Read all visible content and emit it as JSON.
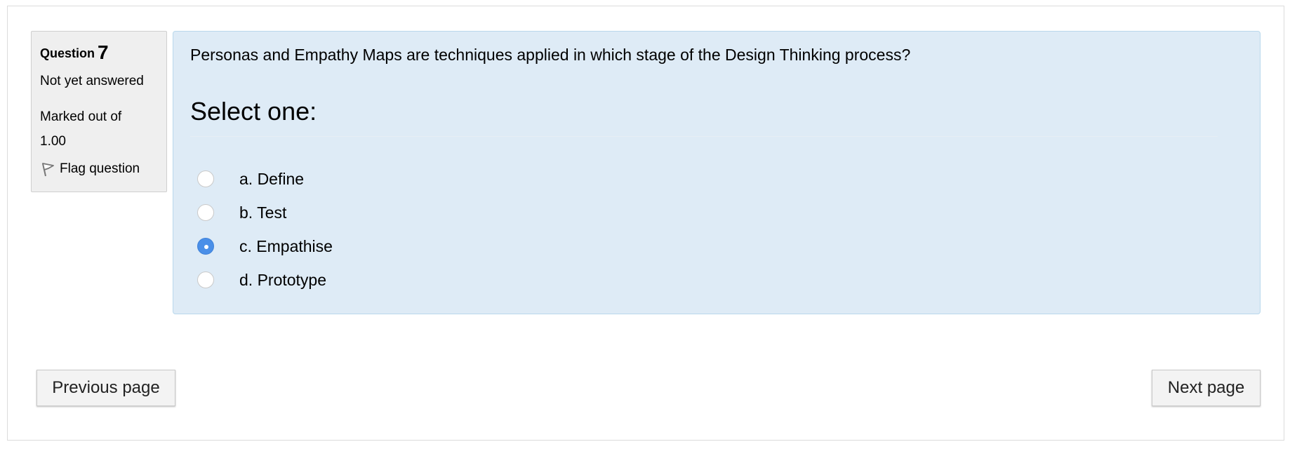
{
  "question_info": {
    "label": "Question",
    "number": "7",
    "state": "Not yet answered",
    "marked_line1": "Marked out of",
    "marked_line2": "1.00",
    "flag_label": "Flag question"
  },
  "question": {
    "text": "Personas and Empathy Maps are techniques applied in which stage of the Design Thinking process?",
    "prompt": "Select one:",
    "answers": [
      {
        "label": "a. Define",
        "checked": false
      },
      {
        "label": "b. Test",
        "checked": false
      },
      {
        "label": "c. Empathise",
        "checked": true
      },
      {
        "label": "d. Prototype",
        "checked": false
      }
    ]
  },
  "navigation": {
    "previous_label": "Previous page",
    "next_label": "Next page"
  },
  "colors": {
    "content_bg": "#deebf6",
    "info_bg": "#efefef",
    "radio_checked": "#4a8fe8"
  },
  "icons": {
    "flag": "flag-icon"
  }
}
